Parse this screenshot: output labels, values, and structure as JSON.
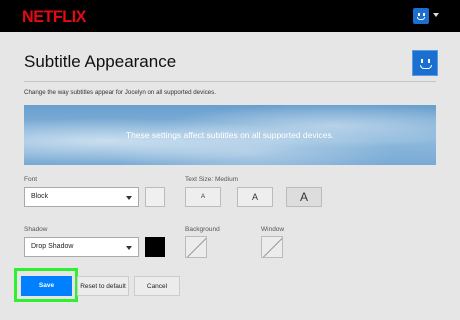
{
  "brand": {
    "logo": "NETFLIX",
    "logo_color": "#e50914",
    "accent": "#0080ff"
  },
  "header": {
    "title": "Subtitle Appearance"
  },
  "description": "Change the way subtitles appear for Jocelyn on all supported devices.",
  "preview": {
    "text": "These settings affect subtitles on all supported devices."
  },
  "font": {
    "label": "Font",
    "value": "Block"
  },
  "text_size": {
    "label": "Text Size: Medium",
    "options": [
      "A",
      "A",
      "A"
    ],
    "selected_index": 2
  },
  "shadow": {
    "label": "Shadow",
    "value": "Drop Shadow"
  },
  "background": {
    "label": "Background"
  },
  "window": {
    "label": "Window"
  },
  "buttons": {
    "save": "Save",
    "reset": "Reset to default",
    "cancel": "Cancel"
  },
  "icons": {
    "profile": "profile-avatar-icon",
    "dropdown": "chevron-down-icon"
  }
}
